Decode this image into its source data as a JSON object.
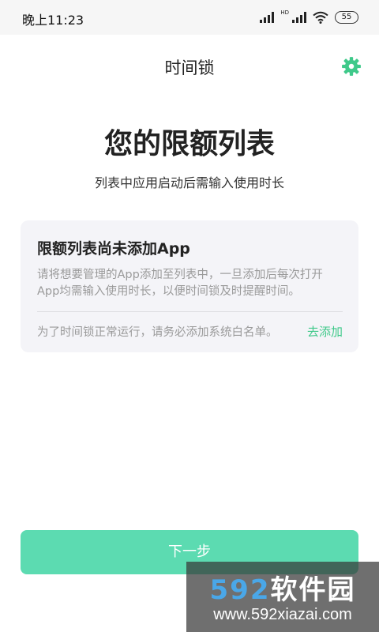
{
  "status_bar": {
    "time": "晚上11:23",
    "hd_label": "HD",
    "battery": "55",
    "icons": [
      "signal-icon",
      "signal-hd-icon",
      "wifi-icon",
      "battery-icon"
    ]
  },
  "header": {
    "title": "时间锁",
    "settings_icon": "gear-icon",
    "accent_color": "#3fc98a"
  },
  "hero": {
    "title": "您的限额列表",
    "subtitle": "列表中应用启动后需输入使用时长"
  },
  "card": {
    "title": "限额列表尚未添加App",
    "description": "请将想要管理的App添加至列表中，一旦添加后每次打开App均需输入使用时长，以便时间锁及时提醒时间。",
    "note": "为了时间锁正常运行，请务必添加系统白名单。",
    "link": "去添加"
  },
  "footer": {
    "next_button": "下一步",
    "button_color": "#5cdbb1"
  },
  "watermark": {
    "brand_num": "592",
    "brand_cn": "软件园",
    "url": "www.592xiazai.com"
  }
}
